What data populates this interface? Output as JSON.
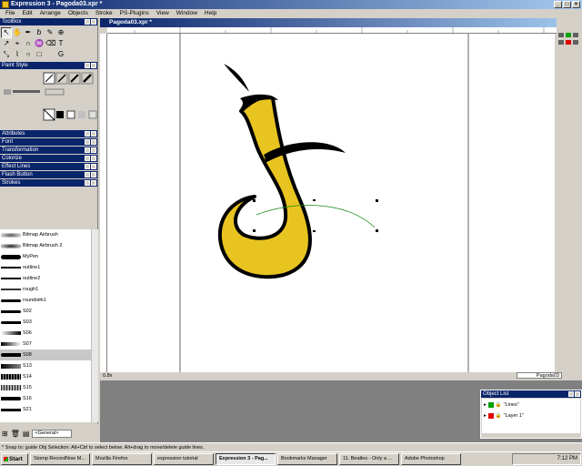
{
  "app": {
    "title": "Expression 3 - Pagoda03.xpr *"
  },
  "menu": [
    "File",
    "Edit",
    "Arrange",
    "Objects",
    "Stroke",
    "PS-Plugins",
    "View",
    "Window",
    "Help"
  ],
  "panels": {
    "toolbox": "ToolBox",
    "paint_style": "Paint Style",
    "collapsed": [
      "Attributes",
      "Font",
      "Transformation",
      "Colorize",
      "Effect Lines",
      "Flash Button",
      "Strokes"
    ]
  },
  "strokes": [
    "Bitmap Airbrush",
    "Bitmap Airbrush 2",
    "MyPen",
    "outline1",
    "outline2",
    "rough1",
    "roundstrk1",
    "S02",
    "S03",
    "S06",
    "S07",
    "S08",
    "S13",
    "S14",
    "S15",
    "S16",
    "S21"
  ],
  "strokes_selected": "S08",
  "strokes_category": "<General>",
  "document": {
    "title": "Pagoda03.xpr *",
    "zoom": "0.8x",
    "name_field": "Pagoda03"
  },
  "object_list": {
    "title": "Object List",
    "layers": [
      {
        "name": "\"Lines\"",
        "color": "#00a000"
      },
      {
        "name": "\"Layer 1\"",
        "color": "#e00000"
      }
    ]
  },
  "status": "* Snap to: guide   Obj Selection: Alt+Ctrl to select below. Alt+drag to move/delete guide lines.",
  "taskbar": {
    "start": "Start",
    "tasks": [
      "Stomp RecordNow M...",
      "Mozilla Firefox",
      "expression tutorial",
      "Expression 3 - Pag...",
      "Bookmarks Manager",
      "11. Beatles - Only a ...",
      "Adobe Photoshop"
    ],
    "active_task": "Expression 3 - Pag...",
    "clock": "7:12 PM"
  },
  "colors": {
    "shape_fill": "#e8c420",
    "guide": "#1a8a1a"
  }
}
